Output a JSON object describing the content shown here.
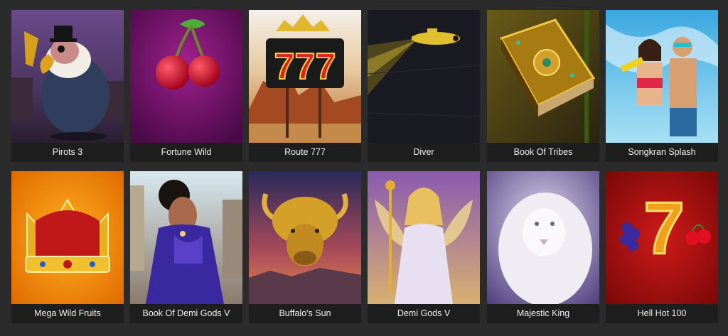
{
  "games": [
    {
      "title": "Pirots 3"
    },
    {
      "title": "Fortune Wild"
    },
    {
      "title": "Route 777"
    },
    {
      "title": "Diver"
    },
    {
      "title": "Book Of Tribes"
    },
    {
      "title": "Songkran Splash"
    },
    {
      "title": "Mega Wild Fruits"
    },
    {
      "title": "Book Of Demi Gods V"
    },
    {
      "title": "Buffalo's Sun"
    },
    {
      "title": "Demi Gods V"
    },
    {
      "title": "Majestic King"
    },
    {
      "title": "Hell Hot 100"
    }
  ],
  "colors": {
    "page_background": "#2b2b2b",
    "caption_background": "#1e1e1e",
    "caption_text": "#f0f0f0"
  }
}
